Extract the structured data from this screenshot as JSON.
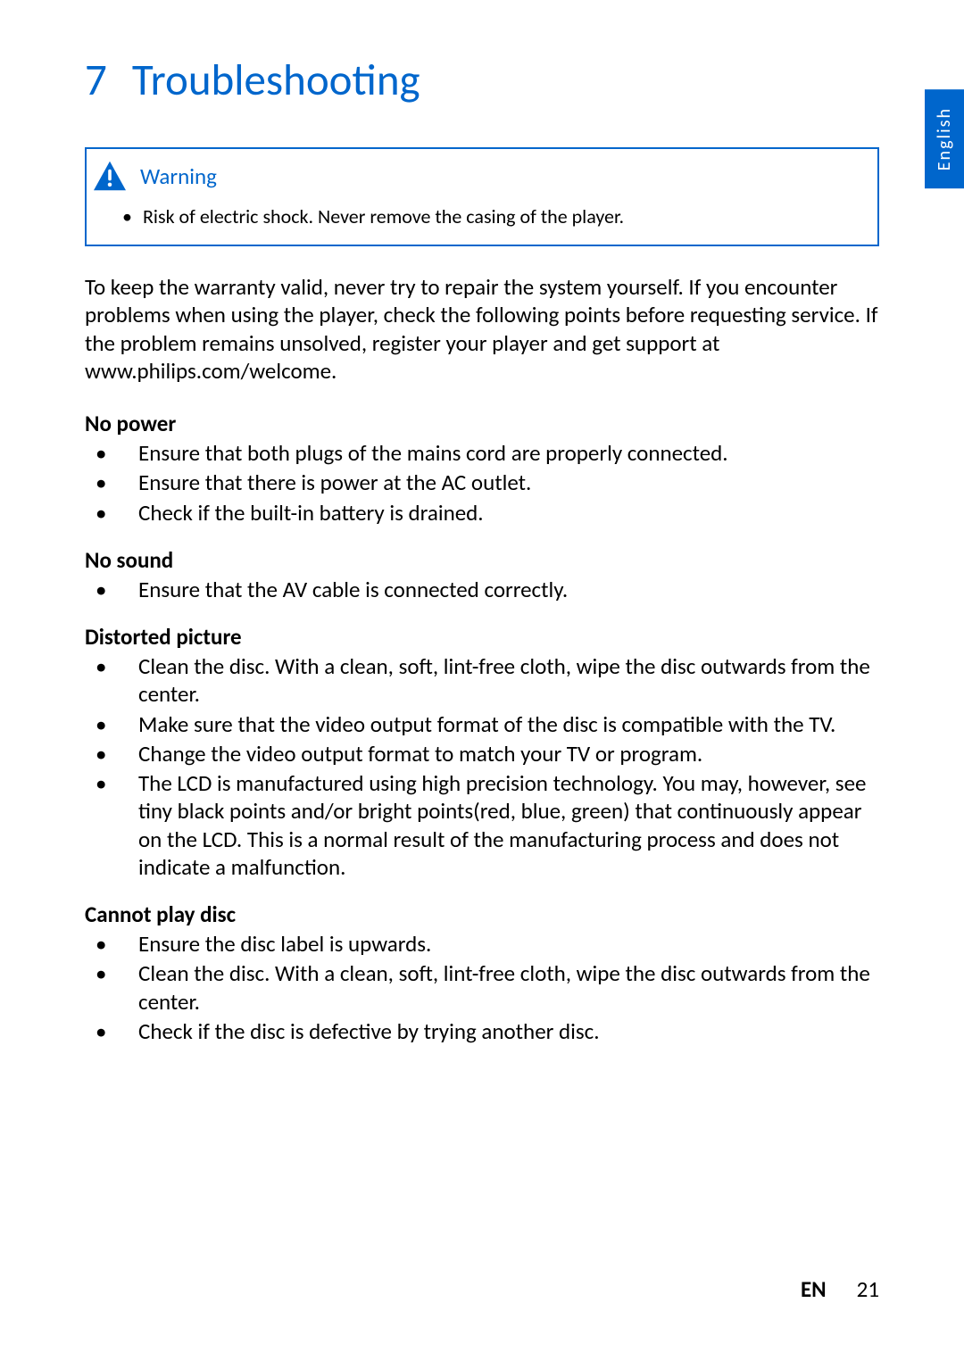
{
  "language_tab": "English",
  "chapter": {
    "number": "7",
    "title": "Troubleshooting"
  },
  "warning": {
    "label": "Warning",
    "text": "Risk of electric shock. Never remove the casing of the player."
  },
  "intro": "To keep the warranty valid, never try to repair the system yourself. If you encounter problems when using the player, check the following points before requesting service. If the problem remains unsolved, register your player and get support at www.philips.com/welcome.",
  "sections": {
    "no_power": {
      "title": "No power",
      "items": [
        "Ensure that both plugs of the mains cord are properly connected.",
        "Ensure that there is power at the AC outlet.",
        "Check if the built-in battery is drained."
      ]
    },
    "no_sound": {
      "title": "No sound",
      "items": [
        "Ensure that the AV cable is connected correctly."
      ]
    },
    "distorted_picture": {
      "title": "Distorted picture",
      "items": [
        "Clean the disc. With a clean, soft, lint-free cloth, wipe the disc outwards from the center.",
        "Make sure that the video output format of the disc is compatible with the TV.",
        "Change the video output format to match your TV or program.",
        "The LCD is manufactured using high precision technology. You may, however, see tiny black points and/or bright points(red, blue, green) that continuously appear on the LCD. This is a normal result of the manufacturing process and does not indicate a malfunction."
      ]
    },
    "cannot_play_disc": {
      "title": "Cannot play disc",
      "items": [
        "Ensure the disc label is upwards.",
        "Clean the disc. With a clean, soft, lint-free cloth, wipe the disc outwards from the center.",
        "Check if the disc is defective by trying another disc."
      ]
    }
  },
  "footer": {
    "lang": "EN",
    "page": "21"
  }
}
